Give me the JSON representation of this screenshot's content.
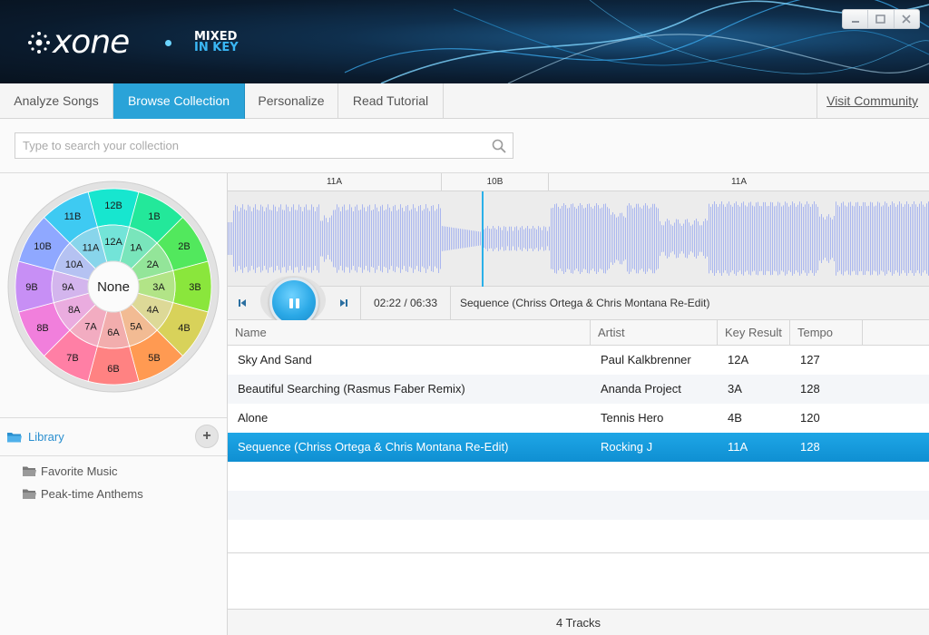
{
  "header": {
    "logo_word": "xone",
    "partner_logo": {
      "line1": "MIXED",
      "line2": "IN KEY"
    },
    "window_controls": [
      "minimize-icon",
      "maximize-icon",
      "close-icon"
    ]
  },
  "tabs": [
    {
      "label": "Analyze Songs",
      "active": false
    },
    {
      "label": "Browse Collection",
      "active": true
    },
    {
      "label": "Personalize",
      "active": false
    },
    {
      "label": "Read Tutorial",
      "active": false
    }
  ],
  "visit_community": "Visit Community",
  "search": {
    "placeholder": "Type to search your collection",
    "value": ""
  },
  "camelot_wheel": {
    "center_label": "None",
    "outer_keys": [
      "12B",
      "1B",
      "2B",
      "3B",
      "4B",
      "5B",
      "6B",
      "7B",
      "8B",
      "9B",
      "10B",
      "11B"
    ],
    "inner_keys": [
      "12A",
      "1A",
      "2A",
      "3A",
      "4A",
      "5A",
      "6A",
      "7A",
      "8A",
      "9A",
      "10A",
      "11A"
    ],
    "colors": [
      "#17e6cf",
      "#23e89a",
      "#52e85d",
      "#8ae63c",
      "#d8d25a",
      "#ff9a52",
      "#ff8282",
      "#ff7fa5",
      "#f17fdc",
      "#c78ff5",
      "#8fa8ff",
      "#3ecaf2"
    ]
  },
  "library": {
    "label": "Library",
    "add_button": "+",
    "playlists": [
      "Favorite Music",
      "Peak-time Anthems"
    ]
  },
  "key_strip": [
    "11A",
    "10B",
    "11A"
  ],
  "transport": {
    "time": "02:22 / 06:33",
    "now_playing": "Sequence (Chriss Ortega & Chris Montana Re-Edit)"
  },
  "table": {
    "columns": [
      "Name",
      "Artist",
      "Key Result",
      "Tempo"
    ],
    "rows": [
      {
        "name": "Sky And Sand",
        "artist": "Paul Kalkbrenner",
        "key": "12A",
        "tempo": "127",
        "selected": false
      },
      {
        "name": "Beautiful Searching (Rasmus Faber Remix)",
        "artist": "Ananda Project",
        "key": "3A",
        "tempo": "128",
        "selected": false
      },
      {
        "name": "Alone",
        "artist": "Tennis Hero",
        "key": "4B",
        "tempo": "120",
        "selected": false
      },
      {
        "name": "Sequence (Chriss Ortega & Chris Montana Re-Edit)",
        "artist": "Rocking J",
        "key": "11A",
        "tempo": "128",
        "selected": true
      },
      {
        "name": "",
        "artist": "",
        "key": "",
        "tempo": "",
        "selected": false
      },
      {
        "name": "",
        "artist": "",
        "key": "",
        "tempo": "",
        "selected": false
      },
      {
        "name": "",
        "artist": "",
        "key": "",
        "tempo": "",
        "selected": false
      }
    ]
  },
  "status": {
    "track_count": "4 Tracks"
  }
}
